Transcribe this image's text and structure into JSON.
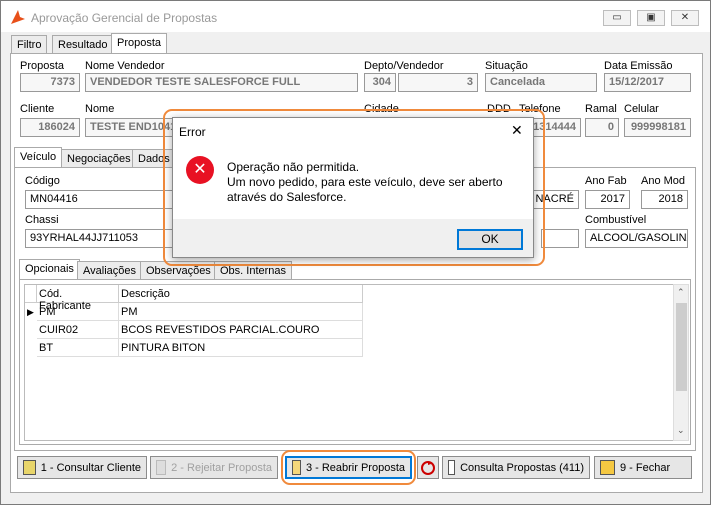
{
  "window": {
    "title": "Aprovação Gerencial de Propostas",
    "minimize": "▭",
    "maximize": "▣",
    "close": "✕"
  },
  "main_tabs": [
    "Filtro",
    "Resultado",
    "Proposta"
  ],
  "header": {
    "proposta_label": "Proposta",
    "proposta_value": "7373",
    "nome_vendedor_label": "Nome Vendedor",
    "nome_vendedor_value": "VENDEDOR TESTE SALESFORCE FULL",
    "depto_label": "Depto/Vendedor",
    "depto_value": "304",
    "vendedor_value": "3",
    "situacao_label": "Situação",
    "situacao_value": "Cancelada",
    "data_label": "Data Emissão",
    "data_value": "15/12/2017"
  },
  "cliente": {
    "cliente_label": "Cliente",
    "cliente_value": "186024",
    "nome_label": "Nome",
    "nome_value": "TESTE END1041",
    "cidade_label": "Cidade",
    "ddd_label": "DDD",
    "telefone_label": "Telefone",
    "telefone_value": "31314444",
    "ramal_label": "Ramal",
    "ramal_value": "0",
    "celular_label": "Celular",
    "celular_value": "999998181"
  },
  "sub_tabs": [
    "Veículo",
    "Negociações",
    "Dados c"
  ],
  "veiculo": {
    "codigo_label": "Código",
    "codigo_value": "MN04416",
    "cor_value": "D NACRÉ",
    "ano_fab_label": "Ano Fab",
    "ano_fab_value": "2017",
    "ano_mod_label": "Ano Mod",
    "ano_mod_value": "2018",
    "chassi_label": "Chassi",
    "chassi_value": "93YRHAL44JJ711053",
    "combustivel_label": "Combustível",
    "combustivel_value": "ALCOOL/GASOLINA"
  },
  "inner_tabs": [
    "Opcionais",
    "Avaliações",
    "Observações",
    "Obs. Internas"
  ],
  "grid": {
    "headers": [
      "Cód. Fabricante",
      "Descrição"
    ],
    "rows": [
      [
        "PM",
        "PM"
      ],
      [
        "CUIR02",
        " BCOS REVESTIDOS PARCIAL.COURO"
      ],
      [
        "BT",
        "PINTURA BITON"
      ]
    ]
  },
  "buttons": {
    "consultar_cliente": "1 - Consultar Cliente",
    "rejeitar_proposta": "2 - Rejeitar Proposta",
    "reabrir_proposta": "3 - Reabrir Proposta",
    "consulta_propostas": "Consulta Propostas (411)",
    "fechar": "9 - Fechar"
  },
  "dialog": {
    "title": "Error",
    "close": "✕",
    "line1": "Operação não permitida.",
    "line2": "Um novo pedido, para este veículo, deve ser aberto",
    "line3": "através do Salesforce.",
    "ok": "OK",
    "icon_glyph": "✕"
  },
  "colors": {
    "highlight": "#f08a3c",
    "error_red": "#e81123",
    "ok_border": "#0078d7"
  }
}
